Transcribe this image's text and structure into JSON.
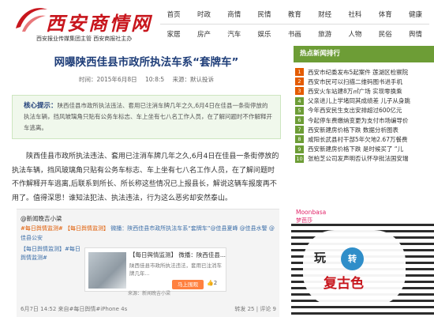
{
  "header": {
    "logo_text": "西安商情网",
    "logo_sub": "西安报业传媒集团主管  西安商报社主办",
    "nav_row1": [
      "首页",
      "时政",
      "商情",
      "民情",
      "教育",
      "财经",
      "社科",
      "体育",
      "健康"
    ],
    "nav_row2": [
      "家居",
      "房产",
      "汽车",
      "娱乐",
      "书画",
      "旅游",
      "人物",
      "民俗",
      "舆情"
    ]
  },
  "article": {
    "title": "网曝陕西佳县市政所执法车系“套牌车”",
    "time_label": "时间：2015年6月8日",
    "time_clock": "10:8:5",
    "source": "来源：默认投诉",
    "summary_label": "核心提示：",
    "summary": "陕西佳县市政所执法违法、套用已注消车牌几年之久,6月4日在佳县一条街停放的执法车辆，挡风玻璃角只贴有公务车标志、车上坐有七八名工作人员，在了解问题时不作解释开车逃离。",
    "body": "陕西佳县市政所执法违法、套用已注消车牌几年之久,6月4日在佳县一条街停放的执法车辆，挡风玻璃角只贴有公务车标志、车上坐有七八名工作人员，在了解问题时不作解释开车逃离,后联系到所长、所长称这些情况已上报县长，解说这辆车报废再不用了。值得深思！谁知法犯法、执法违法，行为这么恶劣却安然泰山。"
  },
  "weibo": {
    "user": "@新闻晚吉小梁",
    "tags_orange": "#每日舆情监测# 【每日舆情监测】",
    "tags_blue": "微播：陕西佳县市政所执法车系“套牌车”@佳县夏峰 @佳县水警 @佳县公安",
    "left_frag": "【每日舆情监测】#每日舆情监测#",
    "card_title": "【每日舆情监测】 微播：陕西佳县...",
    "card_desc": "陕西佳县市政所执法违法，套用已注消车牌几年...",
    "card_origin": "来源：新闻晚吉小梁",
    "card_button": "马上围观",
    "card_like": "2",
    "footer_left": "6月7日 14:52 来自#每日舆情#iPhone 4s",
    "footer_right": "转发 25  |  评论 9"
  },
  "sidebar": {
    "title": "热点新闻排行",
    "items": [
      {
        "num": "1",
        "text": "西安市纪委发布5起案件 莲湖区检察院",
        "color": "#e45b00"
      },
      {
        "num": "2",
        "text": "西安市民可以扫描二维码图书进手机",
        "color": "#e45b00"
      },
      {
        "num": "3",
        "text": "西安火车站建8万㎡广场 实现零换乘",
        "color": "#e45b00"
      },
      {
        "num": "4",
        "text": "父亲进儿上学堵同其成绩差 儿子从身跳",
        "color": "#6d9d36"
      },
      {
        "num": "5",
        "text": "今年西安民生支出安排超过600亿元",
        "color": "#6d9d36"
      },
      {
        "num": "6",
        "text": "今起停车费缴纳变更为支付市场编导价",
        "color": "#6d9d36"
      },
      {
        "num": "7",
        "text": "西安新建房价格下跌 数据分析图表",
        "color": "#6d9d36"
      },
      {
        "num": "8",
        "text": "咸阳长武县村干部5年欠地2.67万餐费",
        "color": "#6d9d36"
      },
      {
        "num": "9",
        "text": "西安新建房价格下跌 是时候买了 “儿",
        "color": "#6d9d36"
      },
      {
        "num": "10",
        "text": "张柏芝公司发声明否认怀孕批法国安瑞",
        "color": "#6d9d36"
      }
    ]
  },
  "ad": {
    "brand": "Moonbasa",
    "brand_cn": "梦芭莎",
    "circle": "转",
    "play": "玩",
    "retro": "复古色"
  }
}
